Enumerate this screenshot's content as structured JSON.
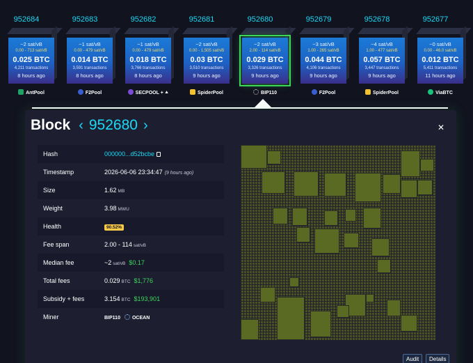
{
  "blocks": [
    {
      "height": "952684",
      "fee": "~2 sat/vB",
      "range": "0.00 - 713 sat/vB",
      "btc": "0.025 BTC",
      "txs": "4,211 transactions",
      "time": "8 hours ago",
      "pool": "AntPool",
      "pool_color": "#1fa364"
    },
    {
      "height": "952683",
      "fee": "~1 sat/vB",
      "range": "0.00 - 479 sat/vB",
      "btc": "0.014 BTC",
      "txs": "3,591 transactions",
      "time": "8 hours ago",
      "pool": "F2Pool",
      "pool_color": "#3b5ccc"
    },
    {
      "height": "952682",
      "fee": "~1 sat/vB",
      "range": "0.00 - 479 sat/vB",
      "btc": "0.018 BTC",
      "txs": "3,766 transactions",
      "time": "8 hours ago",
      "pool": "SECPOOL + ⯅",
      "pool_color": "#7a4cd6"
    },
    {
      "height": "952681",
      "fee": "~2 sat/vB",
      "range": "0.00 - 1,505 sat/vB",
      "btc": "0.03 BTC",
      "txs": "3,510 transactions",
      "time": "9 hours ago",
      "pool": "SpiderPool",
      "pool_color": "#f2c12e"
    },
    {
      "height": "952680",
      "fee": "~2 sat/vB",
      "range": "2.00 - 114 sat/vB",
      "btc": "0.029 BTC",
      "txs": "3,326 transactions",
      "time": "9 hours ago",
      "pool": "BIP110",
      "pool_color": "#888888"
    },
    {
      "height": "952679",
      "fee": "~3 sat/vB",
      "range": "1.00 - 265 sat/vB",
      "btc": "0.044 BTC",
      "txs": "4,106 transactions",
      "time": "9 hours ago",
      "pool": "F2Pool",
      "pool_color": "#3b5ccc"
    },
    {
      "height": "952678",
      "fee": "~4 sat/vB",
      "range": "1.00 - 477 sat/vB",
      "btc": "0.057 BTC",
      "txs": "3,447 transactions",
      "time": "9 hours ago",
      "pool": "SpiderPool",
      "pool_color": "#f2c12e"
    },
    {
      "height": "952677",
      "fee": "~0 sat/vB",
      "range": "0.00 - 46.0 sat/vB",
      "btc": "0.012 BTC",
      "txs": "5,411 transactions",
      "time": "11 hours ago",
      "pool": "ViaBTC",
      "pool_color": "#19c37d"
    }
  ],
  "block": {
    "title_word": "Block",
    "prev": "‹",
    "number": "952680",
    "next": "›",
    "close": "✕",
    "rows": {
      "hash_label": "Hash",
      "hash_value": "000000...d52bcbe",
      "timestamp_label": "Timestamp",
      "timestamp_value": "2026-06-06 23:34:47",
      "timestamp_ago": "(9 hours ago)",
      "size_label": "Size",
      "size_value": "1.62",
      "size_unit": "MB",
      "weight_label": "Weight",
      "weight_value": "3.98",
      "weight_unit": "MWU",
      "health_label": "Health",
      "health_value": "90.52%",
      "feespan_label": "Fee span",
      "feespan_value": "2.00 - 114",
      "feespan_unit": "sat/vB",
      "median_label": "Median fee",
      "median_value": "~2",
      "median_unit": "sat/vB",
      "median_usd": "$0.17",
      "total_label": "Total fees",
      "total_value": "0.029",
      "total_unit": "BTC",
      "total_usd": "$1,776",
      "subsidy_label": "Subsidy + fees",
      "subsidy_value": "3.154",
      "subsidy_unit": "BTC",
      "subsidy_usd": "$193,901",
      "miner_label": "Miner",
      "miner_tag": "BIP110",
      "miner_pool": "OCEAN"
    },
    "audit_label": "Audit",
    "details_label": "Details"
  }
}
